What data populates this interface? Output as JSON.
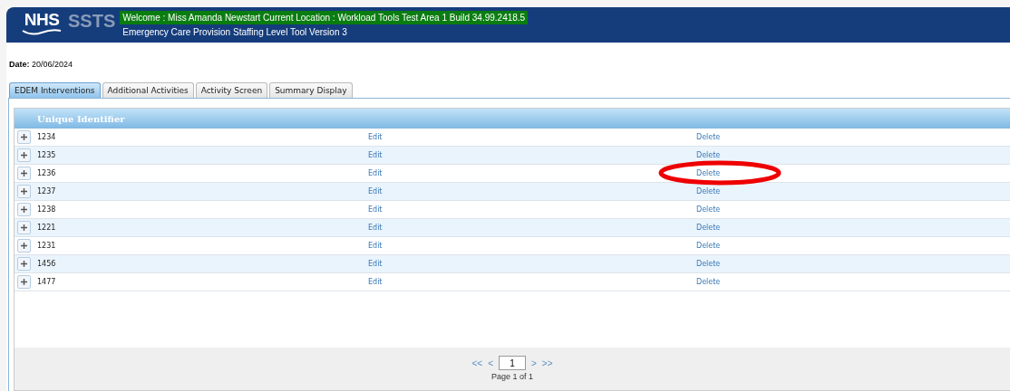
{
  "header": {
    "logo_nhs": "NHS",
    "logo_product": "SSTS",
    "welcome": "Welcome : Miss Amanda Newstart Current Location : Workload Tools Test Area 1 Build 34.99.2418.5",
    "subtitle": "Emergency Care Provision Staffing Level Tool Version 3"
  },
  "date": {
    "label": "Date:",
    "value": "20/06/2024"
  },
  "tabs": [
    {
      "label": "EDEM Interventions",
      "selected": true
    },
    {
      "label": "Additional Activities",
      "selected": false
    },
    {
      "label": "Activity Screen",
      "selected": false
    },
    {
      "label": "Summary Display",
      "selected": false
    }
  ],
  "table": {
    "columns": [
      "Unique Identifier"
    ],
    "rows": [
      {
        "id": "1234",
        "edit": "Edit",
        "delete": "Delete"
      },
      {
        "id": "1235",
        "edit": "Edit",
        "delete": "Delete"
      },
      {
        "id": "1236",
        "edit": "Edit",
        "delete": "Delete"
      },
      {
        "id": "1237",
        "edit": "Edit",
        "delete": "Delete"
      },
      {
        "id": "1238",
        "edit": "Edit",
        "delete": "Delete"
      },
      {
        "id": "1221",
        "edit": "Edit",
        "delete": "Delete"
      },
      {
        "id": "1231",
        "edit": "Edit",
        "delete": "Delete"
      },
      {
        "id": "1456",
        "edit": "Edit",
        "delete": "Delete"
      },
      {
        "id": "1477",
        "edit": "Edit",
        "delete": "Delete"
      }
    ]
  },
  "pager": {
    "first": "<<",
    "prev": "<",
    "page": "1",
    "next": ">",
    "last": ">>",
    "status": "Page 1 of 1"
  }
}
